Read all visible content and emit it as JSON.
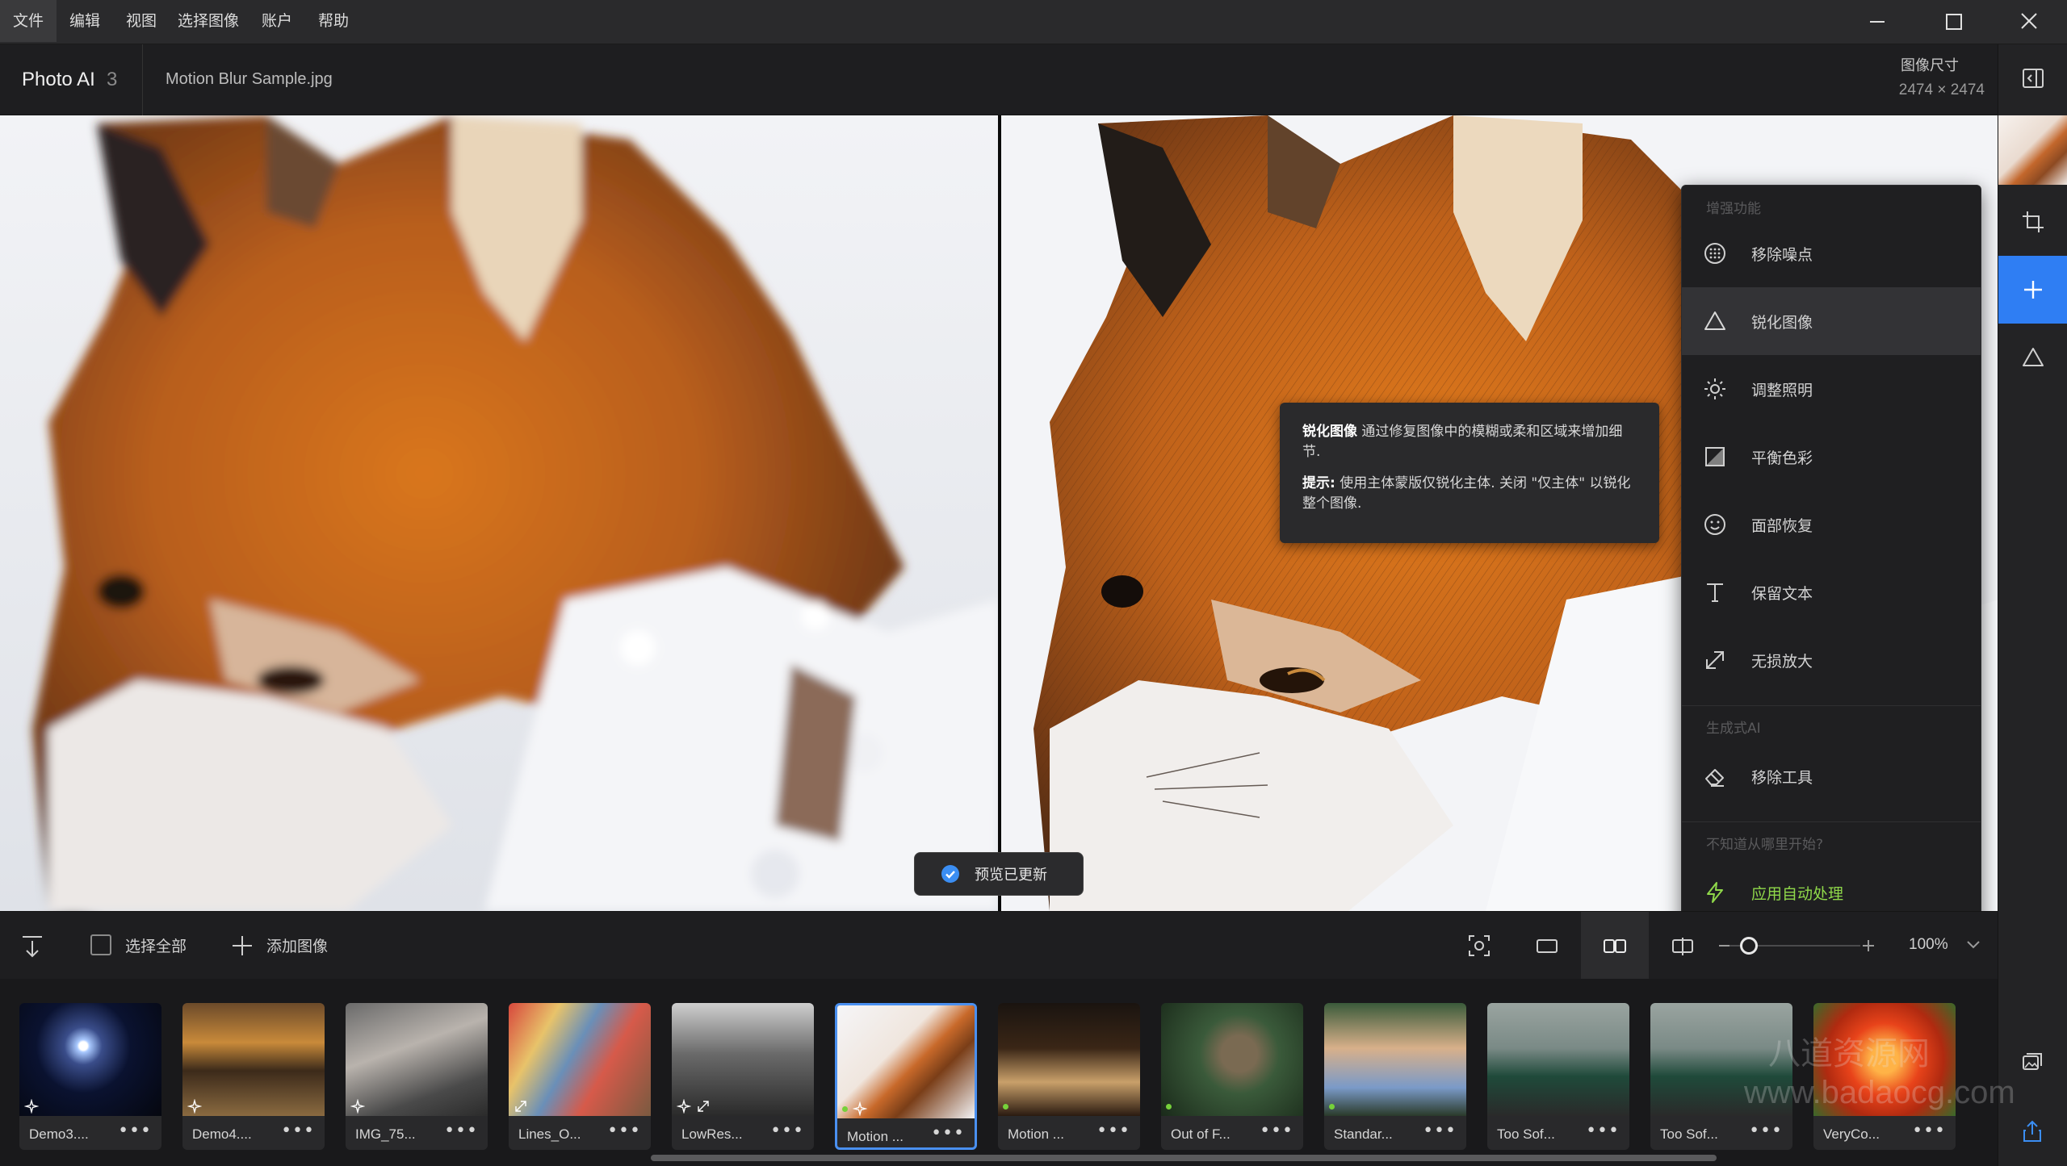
{
  "menu": {
    "items": [
      "文件",
      "编辑",
      "视图",
      "选择图像",
      "账户",
      "帮助"
    ]
  },
  "header": {
    "app_name": "Photo AI",
    "app_version": "3",
    "file_name": "Motion Blur Sample.jpg",
    "image_size_label": "图像尺寸",
    "image_size_value": "2474 × 2474"
  },
  "tooltip": {
    "title": "锐化图像",
    "body": " 通过修复图像中的模糊或柔和区域来增加细节.",
    "tip_label": "提示:",
    "tip_body": " 使用主体蒙版仅锐化主体. 关闭 \"仅主体\" 以锐化整个图像."
  },
  "toast": {
    "text": "预览已更新"
  },
  "enhance_panel": {
    "section_enhance": "增强功能",
    "items": [
      {
        "label": "移除噪点",
        "icon": "noise-icon"
      },
      {
        "label": "锐化图像",
        "icon": "sharpen-icon",
        "active": true
      },
      {
        "label": "调整照明",
        "icon": "light-icon"
      },
      {
        "label": "平衡色彩",
        "icon": "color-balance-icon"
      },
      {
        "label": "面部恢复",
        "icon": "face-icon"
      },
      {
        "label": "保留文本",
        "icon": "text-icon"
      },
      {
        "label": "无损放大",
        "icon": "upscale-icon"
      }
    ],
    "section_generative": "生成式AI",
    "generative_items": [
      {
        "label": "移除工具",
        "icon": "eraser-icon"
      }
    ],
    "section_help": "不知道从哪里开始?",
    "auto_label": "应用自动处理",
    "accent_color": "#8fd84a"
  },
  "bottom_toolbar": {
    "select_all": "选择全部",
    "add_image": "添加图像",
    "zoom": "100%",
    "zoom_fraction": 0.15
  },
  "filmstrip": [
    {
      "name": "Demo3....",
      "badges": "ai"
    },
    {
      "name": "Demo4....",
      "badges": "ai"
    },
    {
      "name": "IMG_75...",
      "badges": "ai"
    },
    {
      "name": "Lines_O...",
      "badges": "upscale"
    },
    {
      "name": "LowRes...",
      "badges": "ai-upscale"
    },
    {
      "name": "Motion ...",
      "badges": "dot-ai",
      "selected": true
    },
    {
      "name": "Motion ...",
      "badges": "dot"
    },
    {
      "name": "Out of F...",
      "badges": "dot"
    },
    {
      "name": "Standar...",
      "badges": "dot"
    },
    {
      "name": "Too Sof...",
      "badges": ""
    },
    {
      "name": "Too Sof...",
      "badges": ""
    },
    {
      "name": "VeryCo...",
      "badges": ""
    }
  ],
  "watermark": {
    "line1": "八道资源网",
    "line2": "www.badaocg.com"
  },
  "colors": {
    "accent_blue": "#2f7ef3",
    "selection_border": "#4a90f0"
  }
}
